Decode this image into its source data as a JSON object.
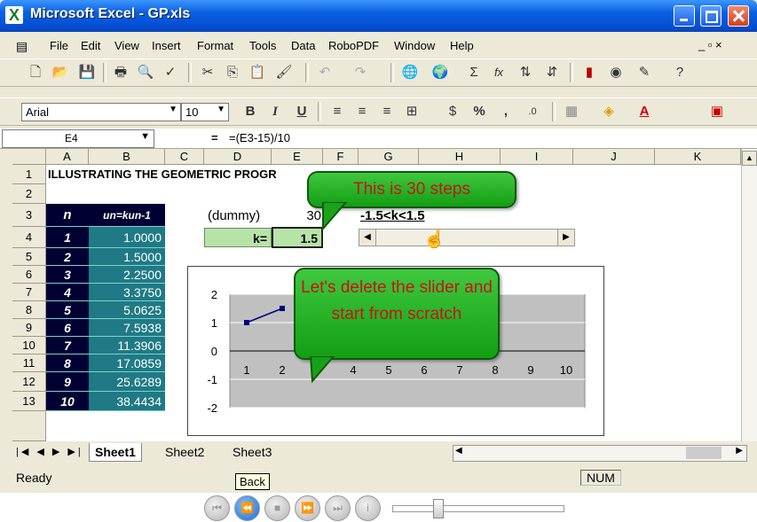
{
  "window": {
    "title": "Microsoft Excel - GP.xls"
  },
  "menu": [
    "File",
    "Edit",
    "View",
    "Insert",
    "Format",
    "Tools",
    "Data",
    "RoboPDF",
    "Window",
    "Help"
  ],
  "toolbar": {
    "font_name": "Arial",
    "font_size": "10",
    "bold": "B",
    "italic": "I",
    "underline": "U",
    "sigma": "Σ",
    "fx": "fx",
    "percent": "%",
    "comma": ","
  },
  "formula_bar": {
    "name_box": "E4",
    "equals": "=",
    "formula": "=(E3-15)/10"
  },
  "columns": [
    "A",
    "B",
    "C",
    "D",
    "E",
    "F",
    "G",
    "H",
    "I",
    "J",
    "K"
  ],
  "rows": [
    "1",
    "2",
    "3",
    "4",
    "5",
    "6",
    "7",
    "8",
    "9",
    "10",
    "11",
    "12",
    "13"
  ],
  "cells": {
    "a1": "ILLUSTRATING THE GEOMETRIC PROGR",
    "a3": "n",
    "b3": "un=kun-1",
    "d3": "(dummy)",
    "e3": "30",
    "g3": "-1.5<k<1.5",
    "d4": "k=",
    "e4": "1.5"
  },
  "table": {
    "n": [
      "1",
      "2",
      "3",
      "4",
      "5",
      "6",
      "7",
      "8",
      "9",
      "10"
    ],
    "u": [
      "1.0000",
      "1.5000",
      "2.2500",
      "3.3750",
      "5.0625",
      "7.5938",
      "11.3906",
      "17.0859",
      "25.6289",
      "38.4434"
    ]
  },
  "chart_data": {
    "type": "line",
    "x": [
      1,
      2,
      3,
      4,
      5,
      6,
      7,
      8,
      9,
      10
    ],
    "y_axis_ticks": [
      "2",
      "1",
      "0",
      "-1",
      "-2"
    ],
    "x_axis_ticks": [
      "1",
      "2",
      "3",
      "4",
      "5",
      "6",
      "7",
      "8",
      "9",
      "10"
    ],
    "visible_series": {
      "x": [
        1,
        2
      ],
      "y": [
        1.0,
        1.5
      ]
    },
    "ylim": [
      -2,
      2
    ],
    "background_color": "#c0c0c0",
    "line_color": "#000080"
  },
  "callouts": {
    "steps": "This is 30 steps",
    "delete": "Let's delete the slider and start from scratch"
  },
  "tabs": [
    "Sheet1",
    "Sheet2",
    "Sheet3"
  ],
  "status": {
    "ready": "Ready",
    "num": "NUM"
  },
  "player": {
    "tooltip": "Back"
  }
}
